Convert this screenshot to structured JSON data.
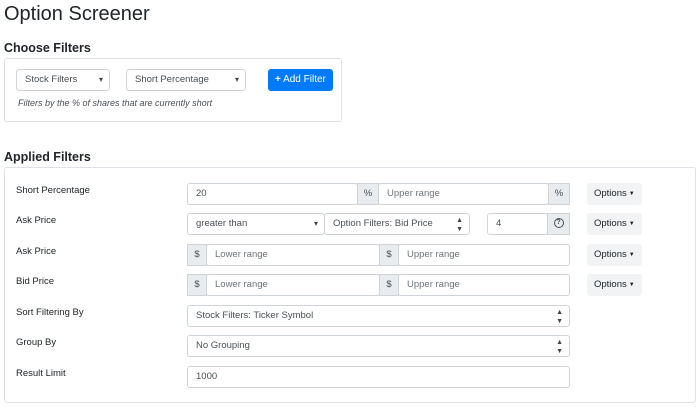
{
  "page": {
    "title": "Option Screener"
  },
  "choose_filters": {
    "heading": "Choose Filters",
    "category_select": "Stock Filters",
    "field_select": "Short Percentage",
    "add_button": "Add Filter",
    "add_icon": "plus-icon",
    "hint": "Filters by the % of shares that are currently short"
  },
  "applied_filters": {
    "heading": "Applied Filters",
    "rows": [
      {
        "label": "Short Percentage",
        "value": "20",
        "unit_left": "%",
        "upper_placeholder": "Upper range",
        "unit_right": "%",
        "options": "Options"
      },
      {
        "label": "Ask Price",
        "comparator": "greater than",
        "compare_field": "Option Filters: Bid Price",
        "value": "4",
        "options": "Options"
      },
      {
        "label": "Ask Price",
        "prefix": "$",
        "lower_placeholder": "Lower range",
        "prefix2": "$",
        "upper_placeholder": "Upper range",
        "options": "Options"
      },
      {
        "label": "Bid Price",
        "prefix": "$",
        "lower_placeholder": "Lower range",
        "prefix2": "$",
        "upper_placeholder": "Upper range",
        "options": "Options"
      },
      {
        "label": "Sort Filtering By",
        "value": "Stock Filters: Ticker Symbol"
      },
      {
        "label": "Group By",
        "value": "No Grouping"
      },
      {
        "label": "Result Limit",
        "value": "1000"
      }
    ]
  }
}
